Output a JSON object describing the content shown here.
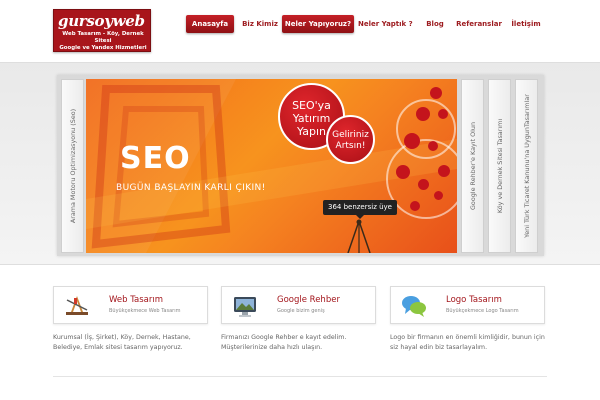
{
  "logo": {
    "name": "gursoyweb",
    "tagline_lines": [
      "Web Tasarım - Köy, Dernek Sitesi",
      "Google ve Yandex Hizmetleri"
    ]
  },
  "nav": {
    "items": [
      {
        "label": "Anasayfa",
        "active": true
      },
      {
        "label": "Biz Kimiz",
        "active": false
      },
      {
        "label": "Neler Yapıyoruz?",
        "active": true
      },
      {
        "label": "Neler Yaptık ?",
        "active": false
      },
      {
        "label": "Blog",
        "active": false
      },
      {
        "label": "Referanslar",
        "active": false
      },
      {
        "label": "İletişim",
        "active": false
      }
    ]
  },
  "slider": {
    "left_tab": "Arama Motoru Optimizasyonu (Seo)",
    "right_tabs": [
      "Google Rehber'e Kayıt Olun",
      "Köy ve Dernek Sitesi Tasarımı",
      "Yeni Türk Ticaret Kanunu'na UygunTasarımlar"
    ],
    "banner": {
      "headline": "SEO",
      "slogan": "BUGÜN BAŞLAYIN KARLI ÇIKIN!",
      "bubble_main": [
        "SEO'ya",
        "Yatırım",
        "Yapın"
      ],
      "bubble_secondary": [
        "Geliriniz",
        "Artsın!"
      ],
      "member_count": "364 benzersiz üye"
    }
  },
  "features": [
    {
      "title": "Web Tasarım",
      "subtitle": "Büyükçekmece Web Tasarım",
      "icon": "design-tools-icon",
      "description": "Kurumsal (İş, Şirket), Köy, Dernek, Hastane, Belediye, Emlak sitesi tasarım yapıyoruz."
    },
    {
      "title": "Google Rehber",
      "subtitle": "Google bizim geniş",
      "icon": "monitor-icon",
      "description": "Firmanızı Google Rehber e kayıt edelim. Müşterilerinize daha hızlı ulaşın."
    },
    {
      "title": "Logo Tasarım",
      "subtitle": "Büyükçekmece Logo Tasarım",
      "icon": "speech-bubbles-icon",
      "description": "Logo bir firmanın en önemli kimliğidir, bunun için siz hayal edin biz tasarlayalım."
    }
  ],
  "colors": {
    "brand_red": "#a8151b",
    "banner_orange": "#f58220",
    "link_red": "#9d1b1f"
  }
}
